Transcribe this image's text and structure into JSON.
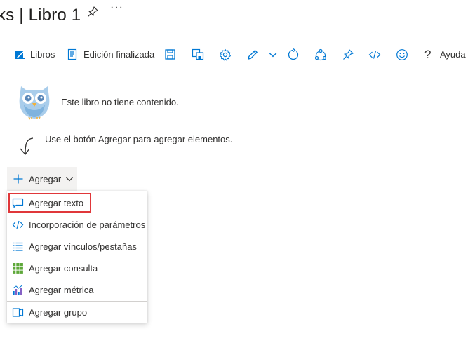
{
  "header": {
    "title": "ks | Libro 1",
    "more": "···",
    "pin_icon": "pin-icon"
  },
  "toolbar": {
    "libros_label": "Libros",
    "edit_done_label": "Edición finalizada",
    "help_label": "Ayuda",
    "icons": [
      "library-icon",
      "edit-done-icon",
      "save-icon",
      "save-as-icon",
      "settings-icon",
      "pencil-icon",
      "chevron-down-icon",
      "refresh-icon",
      "share-icon",
      "pin-icon",
      "code-icon",
      "smiley-icon",
      "help-icon"
    ]
  },
  "empty_state": {
    "message": "Este libro no tiene contenido.",
    "hint": "Use el botón Agregar para agregar elementos."
  },
  "add_button": {
    "label": "Agregar"
  },
  "menu": {
    "items": [
      {
        "label": "Agregar texto",
        "icon": "comment-icon"
      },
      {
        "label": "Incorporación de parámetros",
        "icon": "code-icon"
      },
      {
        "label": "Agregar vínculos/pestañas",
        "icon": "list-icon"
      },
      {
        "label": "Agregar consulta",
        "icon": "grid-icon"
      },
      {
        "label": "Agregar métrica",
        "icon": "bar-chart-icon"
      },
      {
        "label": "Agregar grupo",
        "icon": "group-icon"
      }
    ],
    "highlighted_index": 0,
    "highlight_color": "#e0373a"
  },
  "colors": {
    "accent": "#0078d4",
    "text": "#323130"
  }
}
